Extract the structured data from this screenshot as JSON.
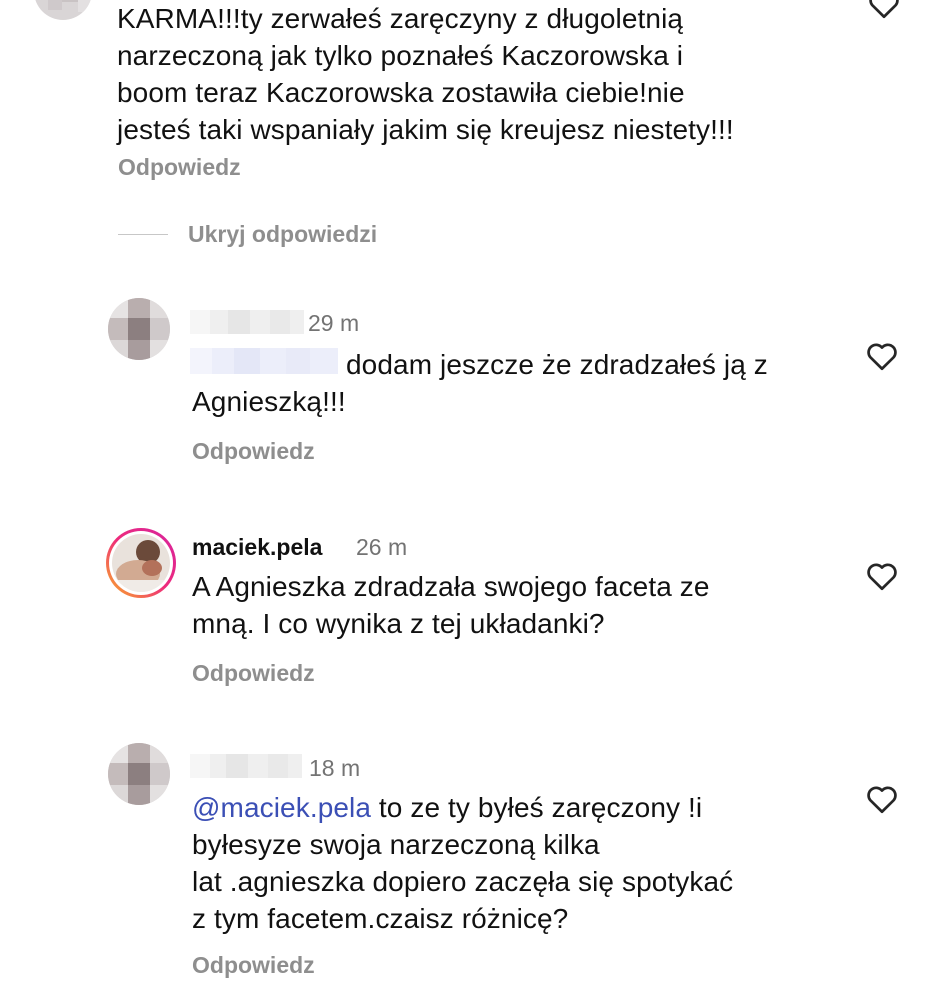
{
  "top_comment": {
    "text_lines": [
      "KARMA!!!ty zerwałeś zaręczyny z długoletnią",
      "narzeczoną jak tylko poznałeś Kaczorowska i",
      "boom teraz Kaczorowska zostawiła ciebie!nie",
      "jesteś taki wspaniały jakim się kreujesz niestety!!!"
    ],
    "reply_label": "Odpowiedz"
  },
  "hide_replies_label": "Ukryj odpowiedzi",
  "replies": [
    {
      "time": "29 m",
      "text_first": "dodam jeszcze że zdradzałeś ją z",
      "text_rest": "Agnieszką!!!",
      "reply_label": "Odpowiedz"
    },
    {
      "username": "maciek.pela",
      "time": "26 m",
      "text_lines": [
        "A Agnieszka zdradzała swojego faceta ze",
        "mną. I co wynika z tej układanki?"
      ],
      "reply_label": "Odpowiedz"
    },
    {
      "time": "18 m",
      "mention": "@maciek.pela",
      "text_first": " to ze ty byłeś zaręczony !i",
      "text_lines": [
        "byłesyze swoja narzeczoną kilka",
        "lat .agnieszka dopiero zaczęła się spotykać",
        "z tym facetem.czaisz różnicę?"
      ],
      "reply_label": "Odpowiedz"
    }
  ],
  "icons": {
    "like": "heart-outline-icon"
  },
  "colors": {
    "text": "#111111",
    "secondary": "#8e8e8e",
    "mention": "#3b4fb5",
    "story_ring_start": "#f9b224",
    "story_ring_end": "#d6249f"
  }
}
